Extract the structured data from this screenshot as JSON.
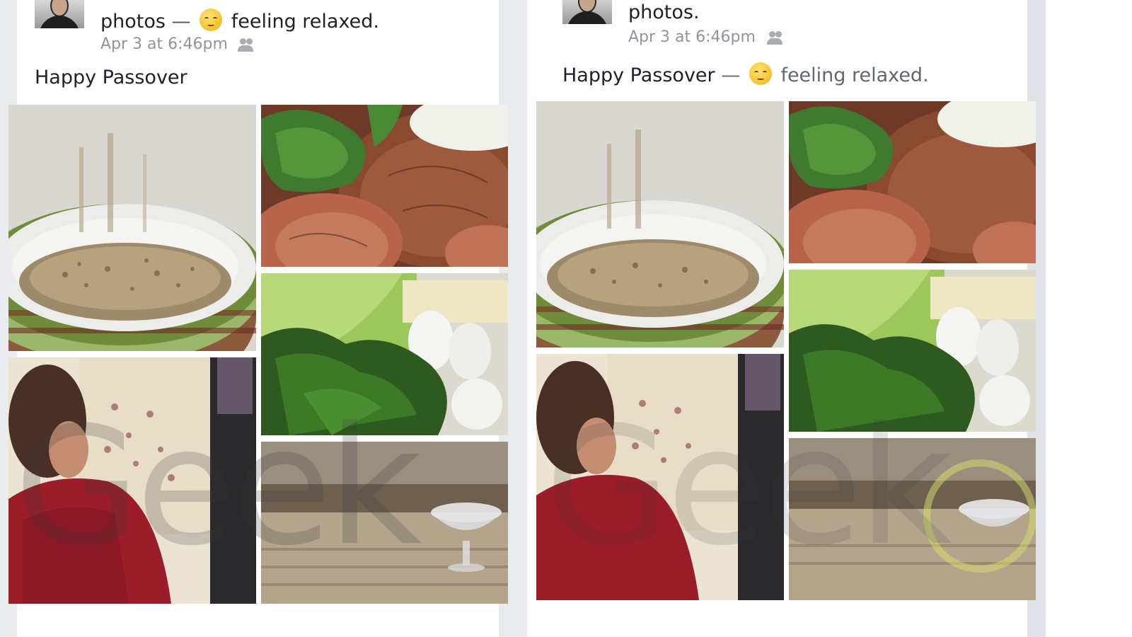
{
  "left_post": {
    "header_text": "photos",
    "feeling_label": "feeling relaxed.",
    "timestamp": "Apr 3 at 6:46pm",
    "message": "Happy Passover"
  },
  "right_post": {
    "header_text": "photos.",
    "timestamp": "Apr 3 at 6:46pm",
    "message": "Happy Passover",
    "feeling_label": "feeling relaxed."
  },
  "separator": "—",
  "icons": {
    "avatar": "profile-avatar",
    "emoji": "relieved-face-emoji",
    "privacy": "friends-icon"
  },
  "photos": [
    "matzo-meal-bowl",
    "seder-plate-with-greens",
    "parsley-lettuce-eggs",
    "family-at-table",
    "glass-bowl-on-table"
  ],
  "watermark": "Geek"
}
